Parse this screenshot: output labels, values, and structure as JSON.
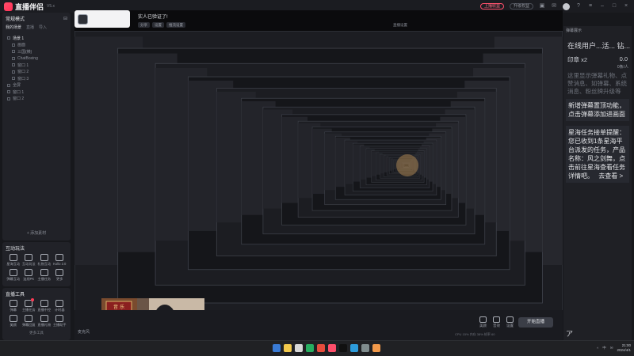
{
  "app": {
    "title": "直播伴侣",
    "version": "V5.x",
    "top_pills": [
      "上播收益",
      "升级权益"
    ],
    "accent": "#ff3b55"
  },
  "scenes": {
    "title": "常规模式",
    "tabs": [
      "我的场景",
      "直播",
      "导入"
    ],
    "items": [
      {
        "label": "场景 1",
        "active": true,
        "indent": false
      },
      {
        "label": "画面",
        "active": false,
        "indent": true
      },
      {
        "label": "三国(横)",
        "active": false,
        "indent": true
      },
      {
        "label": "ChatBoxing",
        "active": false,
        "indent": true
      },
      {
        "label": "窗口 1",
        "active": false,
        "indent": true
      },
      {
        "label": "窗口 2",
        "active": false,
        "indent": true
      },
      {
        "label": "窗口 3",
        "active": false,
        "indent": true
      },
      {
        "label": "全屏",
        "active": false,
        "indent": false
      },
      {
        "label": "窗口 1",
        "active": false,
        "indent": false
      },
      {
        "label": "窗口 2",
        "active": false,
        "indent": false
      }
    ],
    "add_source": "+ 添加素材"
  },
  "interactive": {
    "title": "互动玩法",
    "items": [
      {
        "label": "星海互动",
        "dot": false
      },
      {
        "label": "互动玩法",
        "dot": false
      },
      {
        "label": "礼物互动",
        "dot": false
      },
      {
        "label": "Kollo 2.0",
        "dot": false
      },
      {
        "label": "弹幕互动",
        "dot": false
      },
      {
        "label": "连线PK",
        "dot": false
      },
      {
        "label": "主播任务",
        "dot": false
      },
      {
        "label": "更多",
        "dot": false
      }
    ]
  },
  "tools": {
    "title": "直播工具",
    "items": [
      {
        "label": "弹幕",
        "dot": false
      },
      {
        "label": "主播任务",
        "dot": true
      },
      {
        "label": "直播中控",
        "dot": false
      },
      {
        "label": "计时器",
        "dot": false
      },
      {
        "label": "美颜",
        "dot": false
      },
      {
        "label": "弹幕回复",
        "dot": false
      },
      {
        "label": "直播礼物",
        "dot": false
      },
      {
        "label": "主播助手",
        "dot": false
      }
    ],
    "more": "更多工具"
  },
  "live": {
    "host_name": "实人已验证了!",
    "room_chips": [
      "分享",
      "设置",
      "推流设置"
    ],
    "room_control": "直播设置",
    "perf": "CPU 15%  内存 38%  帧率 60",
    "bottom_left": "麦克风",
    "bottom_icons": [
      "美颜",
      "音效",
      "设置"
    ],
    "go_live": "开始直播",
    "cam_text": "音 乐 坊"
  },
  "right_panel": {
    "header": "弹幕展示",
    "online": "在线用户...活... 钻...",
    "stat_left": "印章",
    "stat_x": "x2",
    "stat_right": "0.0",
    "count": "0条/人",
    "tip": "这里显示弹幕礼物、点赞消息、如弹幕、系统消息、粉丝牌升级等",
    "new_notice": "新增弹幕置顶功能，点击弹幕添加进画面",
    "task_notice": "星海任务接单提醒：您已收到1条星海平台派发的任务，产品名称：风之剑舞，点击前往星海查看任务详情吧。",
    "task_link": "去查看 >",
    "input_icon": "ア"
  },
  "taskbar": {
    "apps": [
      "#3a7bd5",
      "#f2c94c",
      "#d8d8d8",
      "#27ae60",
      "#e74c3c",
      "#ff4e6a",
      "#111111",
      "#2d9cdb",
      "#7f8c8d",
      "#f2994a"
    ],
    "tray": [
      "^",
      "中",
      "✉"
    ],
    "time": "21:00",
    "date": "2024/4/1"
  }
}
